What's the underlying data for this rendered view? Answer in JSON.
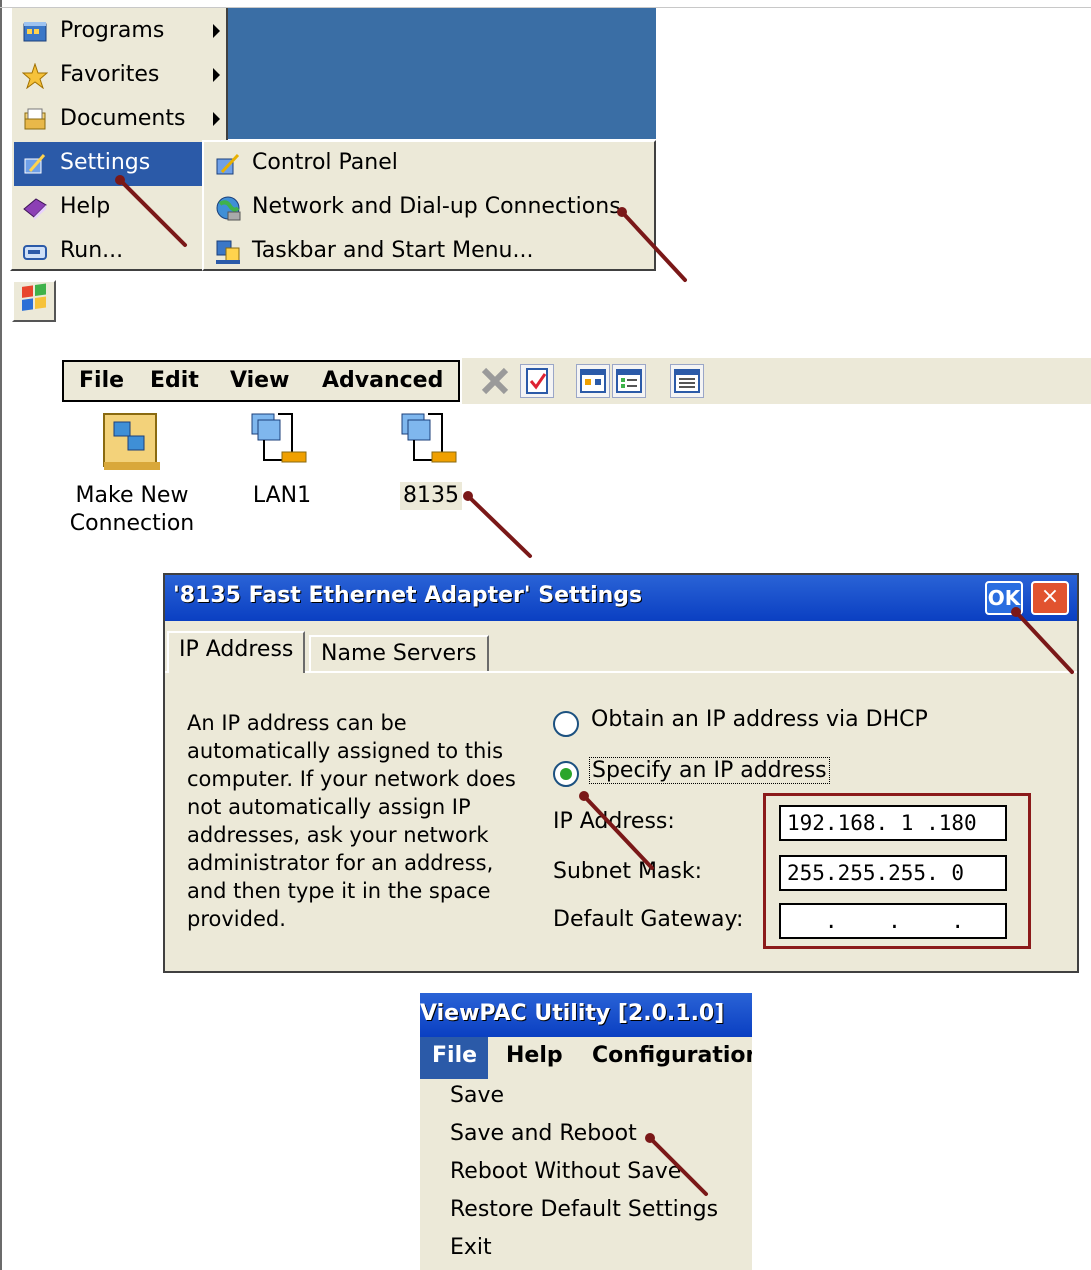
{
  "start_menu": {
    "items": [
      {
        "label": "Programs",
        "icon": "programs-icon",
        "submenu": true
      },
      {
        "label": "Favorites",
        "icon": "favorites-star-icon",
        "submenu": true
      },
      {
        "label": "Documents",
        "icon": "documents-icon",
        "submenu": true
      },
      {
        "label": "Settings",
        "icon": "settings-icon",
        "submenu": false,
        "selected": true
      },
      {
        "label": "Help",
        "icon": "help-book-icon",
        "submenu": false
      },
      {
        "label": "Run...",
        "icon": "run-icon",
        "submenu": false
      }
    ],
    "settings_submenu": [
      {
        "label": "Control Panel",
        "icon": "control-panel-icon"
      },
      {
        "label": "Network and Dial-up Connections",
        "icon": "network-globe-icon"
      },
      {
        "label": "Taskbar and Start Menu...",
        "icon": "taskbar-icon"
      }
    ]
  },
  "explorer": {
    "menu": [
      "File",
      "Edit",
      "View",
      "Advanced"
    ],
    "items": [
      {
        "label": "Make New Connection",
        "icon": "make-new-connection-icon"
      },
      {
        "label": "LAN1",
        "icon": "network-connection-icon"
      },
      {
        "label": "8135",
        "icon": "network-connection-icon"
      }
    ]
  },
  "dialog": {
    "title": "'8135 Fast Ethernet Adapter' Settings",
    "ok_label": "OK",
    "close_label": "×",
    "tabs": [
      "IP Address",
      "Name Servers"
    ],
    "description": "An IP address can be automatically assigned to this computer.  If your network does not automatically assign IP addresses, ask your network administrator for an address, and then type it in the space provided.",
    "radio_dhcp": "Obtain an IP address via DHCP",
    "radio_specify": "Specify an IP address",
    "ip_label": "IP Address:",
    "ip_value": "192.168. 1 .180",
    "subnet_label": "Subnet Mask:",
    "subnet_value": "255.255.255. 0",
    "gateway_label": "Default Gateway:",
    "gateway_value": "   .    .    .   "
  },
  "viewpac": {
    "title": "ViewPAC Utility [2.0.1.0]",
    "menu": [
      "File",
      "Help",
      "Configuration"
    ],
    "file_items": [
      "Save",
      "Save and Reboot",
      "Reboot Without Save",
      "Restore Default Settings",
      "Exit"
    ]
  },
  "colors": {
    "accent_blue": "#2b5aa8",
    "annotation_red": "#8b1a1a",
    "dialog_bg": "#ece9d8"
  }
}
